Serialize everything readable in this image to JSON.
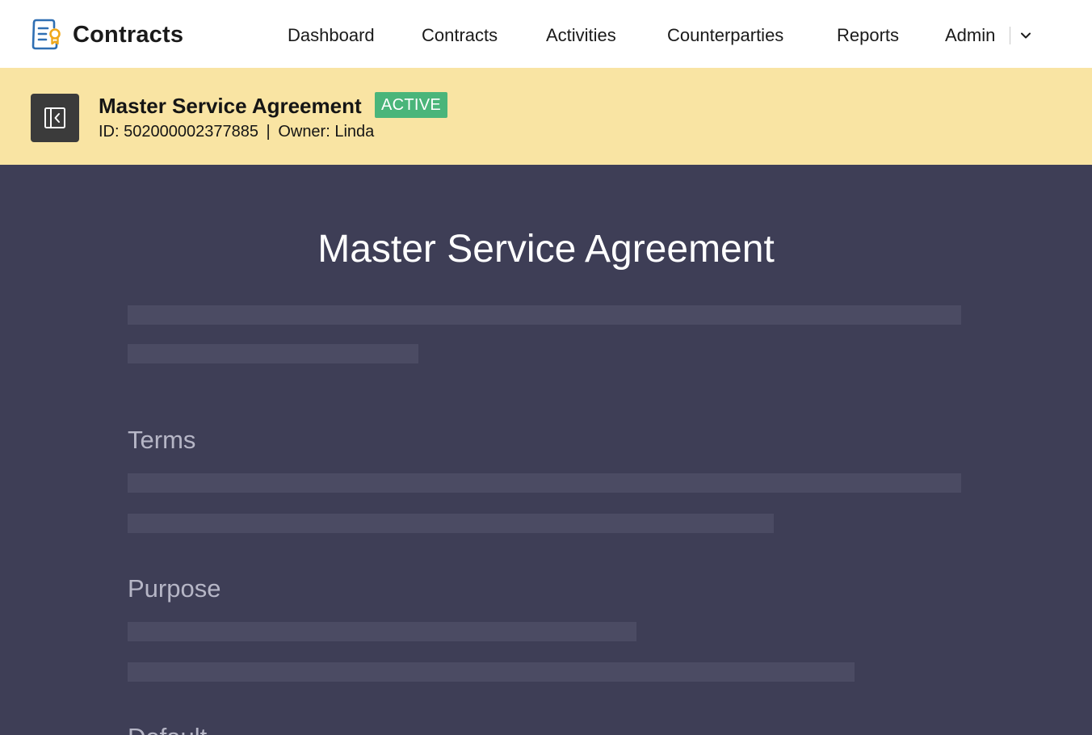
{
  "app": {
    "name": "Contracts",
    "logo_icon": "contract-certificate-icon"
  },
  "nav": {
    "items": [
      "Dashboard",
      "Contracts",
      "Activities",
      "Counterparties",
      "Reports"
    ],
    "user": "Admin",
    "user_menu_icon": "chevron-down-icon"
  },
  "contract": {
    "title": "Master Service Agreement",
    "status": "ACTIVE",
    "status_color": "#4ab57a",
    "id_label": "ID:",
    "id_value": "502000002377885",
    "separator": "|",
    "owner_label": "Owner:",
    "owner_value": "Linda",
    "bar_color": "#f9e4a3",
    "back_icon": "collapse-panel-icon"
  },
  "document": {
    "title": "Master Service Agreement",
    "sections": [
      "Terms",
      "Purpose",
      "Default"
    ],
    "background": "#3e3e56"
  }
}
